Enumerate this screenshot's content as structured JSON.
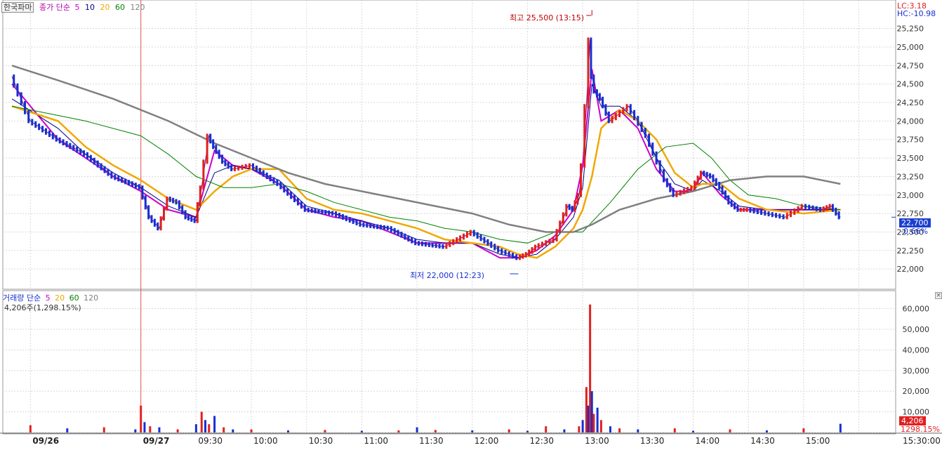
{
  "header": {
    "stock_name": "한국파마",
    "price_label": "종가 단순",
    "ma_periods": [
      "5",
      "10",
      "20",
      "60",
      "120"
    ],
    "lc": "LC:3.18",
    "hc": "HC:-10.98"
  },
  "volume_header": {
    "label": "거래량 단순",
    "ma_periods": [
      "5",
      "20",
      "60",
      "120"
    ],
    "summary": "4,206주(1,298.15%)"
  },
  "annotations": {
    "high": "최고 25,500 (13:15)",
    "low": "최저 22,000 (12:23)"
  },
  "current": {
    "price": "22,700",
    "change": "-0.66%",
    "volume": "4,206",
    "volume_ratio": "1298.15%"
  },
  "colors": {
    "up": "#e02020",
    "down": "#1530d0",
    "ma5": "#cc00cc",
    "ma10": "#000080",
    "ma20": "#f0a800",
    "ma60": "#008000",
    "ma120": "#808080",
    "grid": "#d8d8d8",
    "current_bg": "#1a3fd0",
    "volume_bg": "#e02020"
  },
  "chart_data": [
    {
      "type": "line",
      "title": "한국파마 종가 단순",
      "y_ticks": [
        22000,
        22250,
        22500,
        22750,
        23000,
        23250,
        23500,
        23750,
        24000,
        24250,
        24500,
        24750,
        25000,
        25250
      ],
      "ylim": [
        21840,
        25560
      ],
      "x_ticks": [
        "09/26",
        "09/27",
        "09:30",
        "10:00",
        "10:30",
        "11:00",
        "11:30",
        "12:00",
        "12:30",
        "13:00",
        "13:30",
        "14:00",
        "14:30",
        "15:00",
        "15:30:00"
      ],
      "x_tick_minutes": [
        -60,
        0,
        30,
        60,
        90,
        120,
        150,
        180,
        210,
        240,
        270,
        300,
        330,
        360,
        390
      ],
      "series": [
        {
          "name": "종가",
          "x": [
            -70,
            -60,
            -45,
            -30,
            -15,
            0,
            5,
            10,
            15,
            20,
            25,
            30,
            33,
            37,
            40,
            45,
            50,
            60,
            75,
            90,
            105,
            120,
            135,
            150,
            165,
            180,
            195,
            205,
            210,
            215,
            225,
            232,
            235,
            238,
            240,
            242,
            244,
            245,
            247,
            250,
            255,
            265,
            275,
            285,
            290,
            300,
            305,
            310,
            315,
            320,
            325,
            330,
            340,
            350,
            360,
            370,
            375,
            380
          ],
          "values": [
            24600,
            24000,
            23750,
            23550,
            23250,
            23100,
            22700,
            22550,
            22950,
            22900,
            22700,
            22650,
            23100,
            23800,
            23650,
            23450,
            23350,
            23400,
            23150,
            22800,
            22750,
            22600,
            22550,
            22350,
            22300,
            22500,
            22250,
            22150,
            22200,
            22300,
            22400,
            22850,
            22800,
            23000,
            23400,
            24200,
            25100,
            24600,
            24400,
            24300,
            24000,
            24200,
            23800,
            23200,
            23000,
            23100,
            23300,
            23250,
            23100,
            22900,
            22800,
            22800,
            22750,
            22700,
            22850,
            22800,
            22850,
            22700
          ]
        },
        {
          "name": "5",
          "x": [
            -70,
            -45,
            -30,
            -15,
            0,
            15,
            30,
            40,
            50,
            60,
            75,
            90,
            105,
            120,
            135,
            150,
            165,
            180,
            195,
            205,
            215,
            225,
            235,
            240,
            245,
            250,
            260,
            270,
            280,
            290,
            300,
            305,
            315,
            325,
            340,
            360,
            380
          ],
          "values": [
            24500,
            23750,
            23500,
            23250,
            23050,
            22800,
            22700,
            23600,
            23400,
            23350,
            23150,
            22800,
            22700,
            22650,
            22500,
            22350,
            22350,
            22350,
            22150,
            22150,
            22250,
            22450,
            22800,
            23400,
            24700,
            24000,
            24150,
            23900,
            23350,
            23050,
            23050,
            23300,
            23000,
            22800,
            22800,
            22800,
            22800
          ]
        },
        {
          "name": "10",
          "x": [
            -70,
            -45,
            -30,
            -15,
            0,
            15,
            30,
            40,
            50,
            60,
            75,
            90,
            105,
            120,
            135,
            150,
            165,
            180,
            195,
            205,
            215,
            225,
            235,
            240,
            245,
            250,
            260,
            270,
            280,
            290,
            300,
            305,
            315,
            325,
            340,
            360,
            380
          ],
          "values": [
            24300,
            23900,
            23550,
            23300,
            23100,
            22850,
            22700,
            23300,
            23400,
            23350,
            23200,
            22850,
            22750,
            22650,
            22550,
            22400,
            22350,
            22350,
            22200,
            22150,
            22200,
            22400,
            22700,
            23100,
            24500,
            24200,
            24200,
            24000,
            23500,
            23150,
            23050,
            23200,
            23050,
            22850,
            22800,
            22800,
            22800
          ]
        },
        {
          "name": "20",
          "x": [
            -70,
            -45,
            -30,
            -15,
            0,
            15,
            30,
            40,
            50,
            60,
            75,
            90,
            105,
            120,
            135,
            150,
            165,
            180,
            195,
            205,
            215,
            225,
            235,
            240,
            245,
            250,
            260,
            270,
            280,
            290,
            300,
            305,
            315,
            325,
            340,
            360,
            380
          ],
          "values": [
            24200,
            24000,
            23650,
            23400,
            23200,
            22950,
            22800,
            23050,
            23250,
            23350,
            23350,
            22950,
            22800,
            22750,
            22650,
            22550,
            22400,
            22350,
            22300,
            22200,
            22150,
            22300,
            22550,
            22800,
            23250,
            23900,
            24150,
            24000,
            23750,
            23300,
            23100,
            23150,
            23150,
            22950,
            22800,
            22750,
            22800
          ]
        },
        {
          "name": "60",
          "x": [
            -70,
            -30,
            0,
            15,
            30,
            45,
            60,
            75,
            90,
            105,
            120,
            135,
            150,
            165,
            180,
            195,
            210,
            225,
            240,
            255,
            270,
            285,
            300,
            310,
            320,
            330,
            345,
            360,
            380
          ],
          "values": [
            24200,
            24000,
            23800,
            23550,
            23250,
            23100,
            23100,
            23150,
            23050,
            22900,
            22800,
            22700,
            22650,
            22550,
            22500,
            22400,
            22350,
            22500,
            22500,
            22900,
            23350,
            23650,
            23700,
            23500,
            23200,
            23000,
            22950,
            22850,
            22800
          ]
        },
        {
          "name": "120",
          "x": [
            -70,
            -45,
            -15,
            15,
            40,
            60,
            80,
            100,
            120,
            140,
            160,
            180,
            200,
            220,
            235,
            245,
            260,
            280,
            300,
            320,
            340,
            360,
            380
          ],
          "values": [
            24750,
            24550,
            24300,
            24000,
            23700,
            23500,
            23300,
            23150,
            23050,
            22950,
            22850,
            22750,
            22600,
            22500,
            22500,
            22600,
            22800,
            22950,
            23050,
            23200,
            23250,
            23250,
            23150
          ]
        }
      ]
    },
    {
      "type": "bar",
      "title": "거래량 단순",
      "y_ticks": [
        0,
        10000,
        20000,
        30000,
        40000,
        50000,
        60000
      ],
      "ylim": [
        0,
        66000
      ],
      "x_ticks": [
        "09/26",
        "09/27",
        "09:30",
        "10:00",
        "10:30",
        "11:00",
        "11:30",
        "12:00",
        "12:30",
        "13:00",
        "13:30",
        "14:00",
        "14:30",
        "15:00",
        "15:30:00"
      ],
      "bars": {
        "x": [
          -60,
          -40,
          -20,
          -3,
          0,
          2,
          5,
          10,
          20,
          30,
          33,
          35,
          37,
          40,
          45,
          50,
          60,
          80,
          100,
          120,
          140,
          150,
          160,
          180,
          200,
          210,
          220,
          230,
          238,
          240,
          242,
          243,
          244,
          245,
          246,
          248,
          250,
          255,
          260,
          270,
          290,
          300,
          320,
          340,
          360,
          380
        ],
        "values": [
          3500,
          2000,
          2500,
          1500,
          13000,
          5000,
          3000,
          2500,
          1500,
          4000,
          10000,
          6000,
          4000,
          8000,
          2500,
          1500,
          1500,
          1000,
          1200,
          800,
          1000,
          2500,
          1200,
          1000,
          1500,
          800,
          3000,
          1500,
          3000,
          6000,
          22000,
          13000,
          62000,
          20000,
          9000,
          12000,
          6000,
          3000,
          2000,
          1500,
          2000,
          800,
          1500,
          1000,
          2000,
          4206
        ]
      }
    }
  ]
}
